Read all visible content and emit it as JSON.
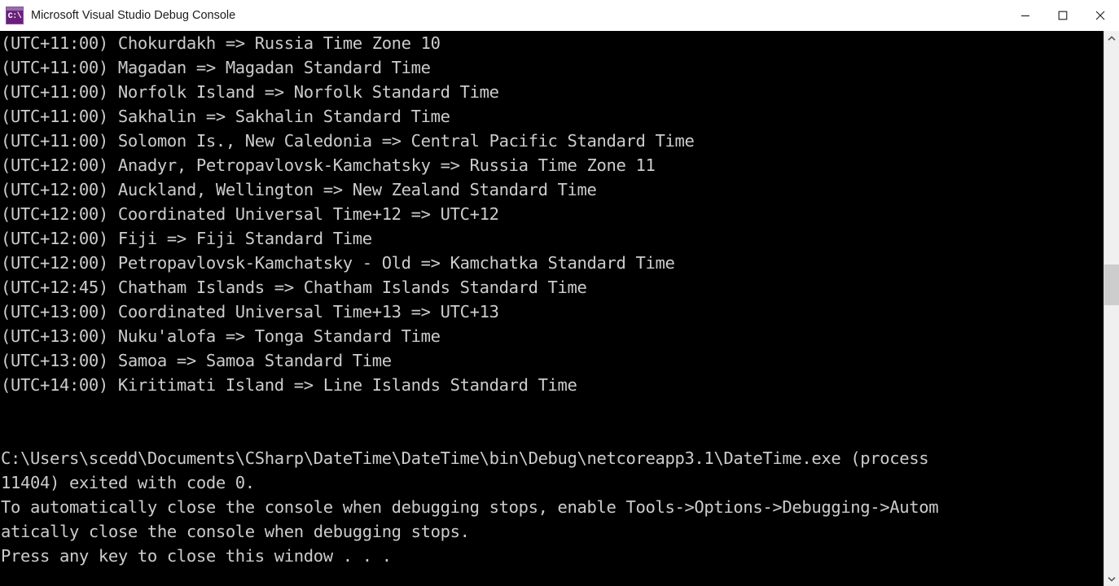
{
  "window": {
    "title": "Microsoft Visual Studio Debug Console",
    "icon": "console-app-icon",
    "icon_glyph": "C:\\",
    "controls": {
      "minimize": "minimize-icon",
      "maximize": "maximize-icon",
      "close": "close-icon"
    }
  },
  "colors": {
    "console_background": "#000000",
    "console_text": "#cccccc",
    "titlebar_background": "#ffffff",
    "titlebar_text": "#1b1b1b",
    "app_icon": "#68217a",
    "scrollbar_track": "#f0f0f0",
    "scrollbar_thumb": "#cdcdcd"
  },
  "console": {
    "lines": [
      "(UTC+11:00) Chokurdakh => Russia Time Zone 10",
      "(UTC+11:00) Magadan => Magadan Standard Time",
      "(UTC+11:00) Norfolk Island => Norfolk Standard Time",
      "(UTC+11:00) Sakhalin => Sakhalin Standard Time",
      "(UTC+11:00) Solomon Is., New Caledonia => Central Pacific Standard Time",
      "(UTC+12:00) Anadyr, Petropavlovsk-Kamchatsky => Russia Time Zone 11",
      "(UTC+12:00) Auckland, Wellington => New Zealand Standard Time",
      "(UTC+12:00) Coordinated Universal Time+12 => UTC+12",
      "(UTC+12:00) Fiji => Fiji Standard Time",
      "(UTC+12:00) Petropavlovsk-Kamchatsky - Old => Kamchatka Standard Time",
      "(UTC+12:45) Chatham Islands => Chatham Islands Standard Time",
      "(UTC+13:00) Coordinated Universal Time+13 => UTC+13",
      "(UTC+13:00) Nuku'alofa => Tonga Standard Time",
      "(UTC+13:00) Samoa => Samoa Standard Time",
      "(UTC+14:00) Kiritimati Island => Line Islands Standard Time",
      "",
      "",
      "C:\\Users\\scedd\\Documents\\CSharp\\DateTime\\DateTime\\bin\\Debug\\netcoreapp3.1\\DateTime.exe (process",
      "11404) exited with code 0.",
      "To automatically close the console when debugging stops, enable Tools->Options->Debugging->Autom",
      "atically close the console when debugging stops.",
      "Press any key to close this window . . ."
    ]
  },
  "scrollbar": {
    "up_arrow": "chevron-up-icon",
    "down_arrow": "chevron-down-icon",
    "thumb": "scrollbar-thumb"
  }
}
